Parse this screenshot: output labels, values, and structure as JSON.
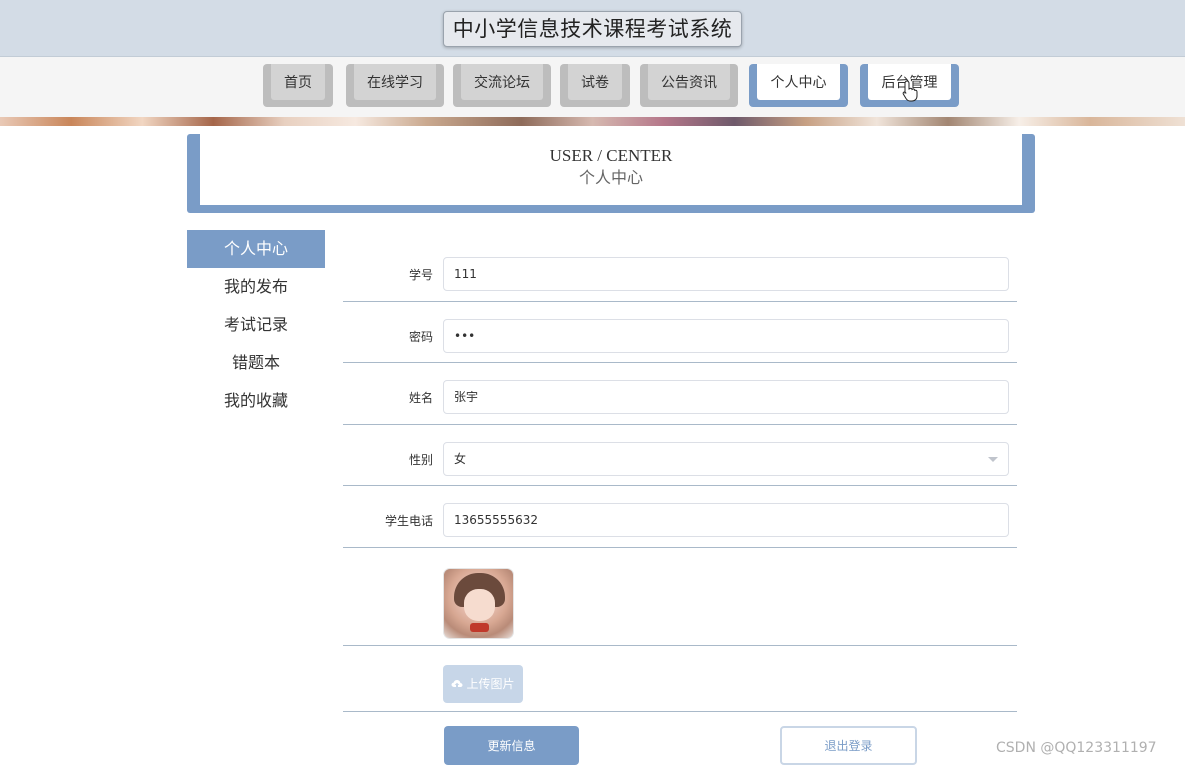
{
  "header": {
    "title": "中小学信息技术课程考试系统"
  },
  "nav": {
    "items": [
      {
        "label": "首页"
      },
      {
        "label": "在线学习"
      },
      {
        "label": "交流论坛"
      },
      {
        "label": "试卷"
      },
      {
        "label": "公告资讯"
      },
      {
        "label": "个人中心"
      },
      {
        "label": "后台管理"
      }
    ],
    "active": "个人中心",
    "accent_color": "#7a9cc7"
  },
  "banner": {
    "title_en": "USER / CENTER",
    "title_cn": "个人中心"
  },
  "sidebar": {
    "items": [
      {
        "label": "个人中心"
      },
      {
        "label": "我的发布"
      },
      {
        "label": "考试记录"
      },
      {
        "label": "错题本"
      },
      {
        "label": "我的收藏"
      }
    ],
    "active": "个人中心"
  },
  "form": {
    "student_id": {
      "label": "学号",
      "value": "111"
    },
    "password": {
      "label": "密码",
      "value": "•••"
    },
    "name": {
      "label": "姓名",
      "value": "张宇"
    },
    "gender": {
      "label": "性别",
      "value": "女"
    },
    "phone": {
      "label": "学生电话",
      "value": "13655555632"
    },
    "upload_label": "上传图片"
  },
  "actions": {
    "update_label": "更新信息",
    "logout_label": "退出登录"
  },
  "watermark": "CSDN @QQ123311197"
}
